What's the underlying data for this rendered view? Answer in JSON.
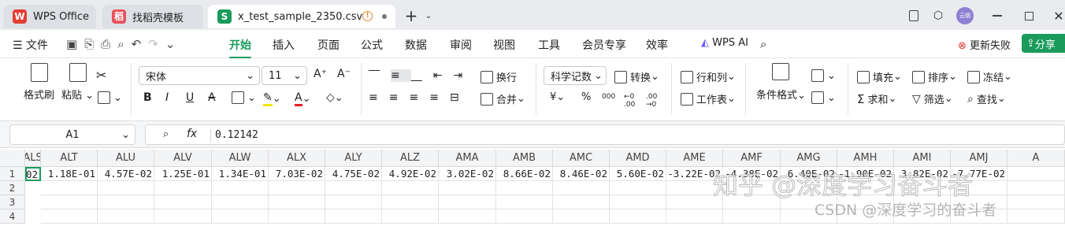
{
  "tabs": [
    {
      "label": "WPS Office",
      "icon": "W"
    },
    {
      "label": "找稻壳模板",
      "icon": "稻"
    },
    {
      "label": "x_test_sample_2350.csv",
      "icon": "S"
    }
  ],
  "tab_status_icon": "!",
  "avatar_text": "云烟",
  "menu": {
    "file": "文件",
    "items": [
      "开始",
      "插入",
      "页面",
      "公式",
      "数据",
      "审阅",
      "视图",
      "工具",
      "会员专享",
      "效率"
    ],
    "wps_ai": "WPS AI",
    "update": "更新失败",
    "share": "分享"
  },
  "ribbon": {
    "format_brush": "格式刷",
    "paste": "粘贴",
    "font_name": "宋体",
    "font_size": "11",
    "wrap": "换行",
    "merge": "合并",
    "number_format": "科学记数",
    "convert": "转换",
    "rows_cols": "行和列",
    "worksheet": "工作表",
    "cond_format": "条件格式",
    "fill": "填充",
    "sort": "排序",
    "freeze": "冻结",
    "sum": "求和",
    "filter": "筛选",
    "find": "查找",
    "currency": "¥",
    "percent": "%",
    "thousands": "000",
    "dec_inc": "←0 .00",
    "dec_dec": ".00 →0"
  },
  "formula": {
    "cell_ref": "A1",
    "fx": "fx",
    "value": "0.12142"
  },
  "sheet": {
    "partial_col": "ALS",
    "columns": [
      "ALT",
      "ALU",
      "ALV",
      "ALW",
      "ALX",
      "ALY",
      "ALZ",
      "AMA",
      "AMB",
      "AMC",
      "AMD",
      "AME",
      "AMF",
      "AMG",
      "AMH",
      "AMI",
      "AMJ",
      "A"
    ],
    "rows": [
      "1",
      "2",
      "3",
      "4"
    ],
    "row1_partial": "02",
    "row1": [
      "1.18E-01",
      "4.57E-02",
      "1.25E-01",
      "1.34E-01",
      "7.03E-02",
      "4.75E-02",
      "4.92E-02",
      "3.02E-02",
      "8.66E-02",
      "8.46E-02",
      "5.60E-02",
      "-3.22E-02",
      "-4.38E-02",
      "6.40E-02",
      "-1.90E-02",
      "3.82E-02",
      "-7.77E-02",
      ""
    ]
  },
  "watermark": {
    "line1": "知乎 @深度学习奋斗者",
    "line2": "CSDN @深度学习的奋斗者"
  }
}
